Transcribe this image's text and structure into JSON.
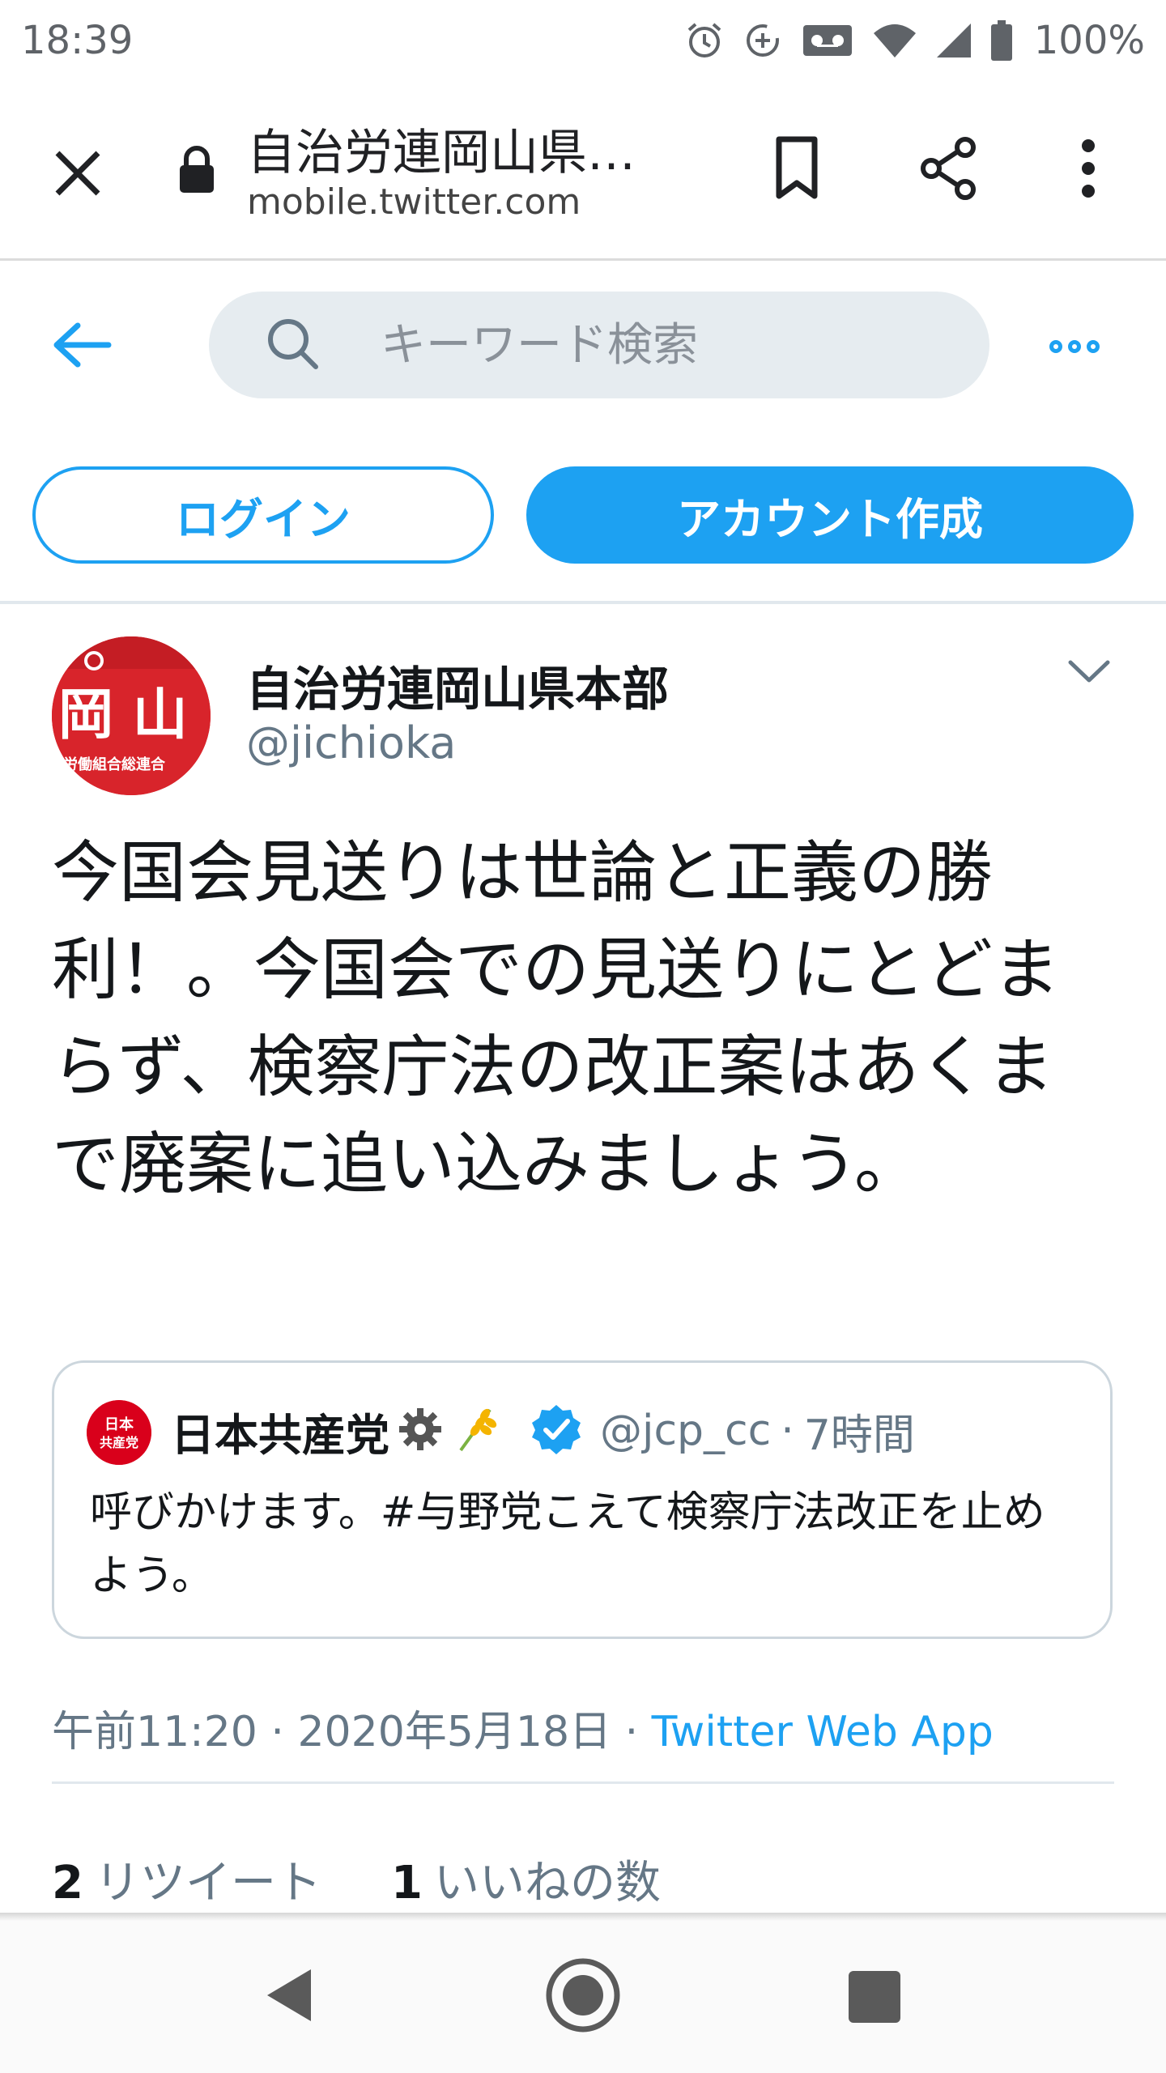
{
  "status_bar": {
    "time": "18:39",
    "battery": "100%",
    "icons": [
      "alarm-icon",
      "data-saver-icon",
      "voicemail-icon",
      "wifi-icon",
      "signal-icon",
      "battery-icon"
    ]
  },
  "browser": {
    "title": "自治労連岡山県…",
    "url": "mobile.twitter.com",
    "icons": [
      "close-icon",
      "lock-icon",
      "bookmark-icon",
      "share-icon",
      "more-vert-icon"
    ]
  },
  "twitter_header": {
    "search_placeholder": "キーワード検索",
    "icons": [
      "back-arrow-icon",
      "search-icon",
      "more-horiz-icon"
    ]
  },
  "auth": {
    "login_label": "ログイン",
    "signup_label": "アカウント作成"
  },
  "tweet": {
    "author_name": "自治労連岡山県本部",
    "author_handle": "@jichioka",
    "avatar_text": "岡 山",
    "avatar_subtext": "労働組合総連合",
    "text": "今国会見送りは世論と正義の勝利！。今国会での見送りにとどまらず、検察庁法の改正案はあくまで廃案に追い込みましょう。",
    "quote": {
      "avatar_text": "日本共産党",
      "name": "日本共産党",
      "handle": "@jcp_cc",
      "separator": "·",
      "time": "7時間",
      "text": "呼びかけます。#与野党こえて検察庁法改正を止めよう。"
    },
    "meta": {
      "time": "午前11:20",
      "separator1": " · ",
      "date": "2020年5月18日",
      "separator2": " · ",
      "source": "Twitter Web App"
    },
    "stats": {
      "retweet_count": "2",
      "retweet_label": "リツイート",
      "like_count": "1",
      "like_label": "いいねの数"
    }
  },
  "colors": {
    "accent": "#1da1f2",
    "text_primary": "#14171a",
    "text_secondary": "#657786",
    "avatar_red": "#d8242b"
  }
}
